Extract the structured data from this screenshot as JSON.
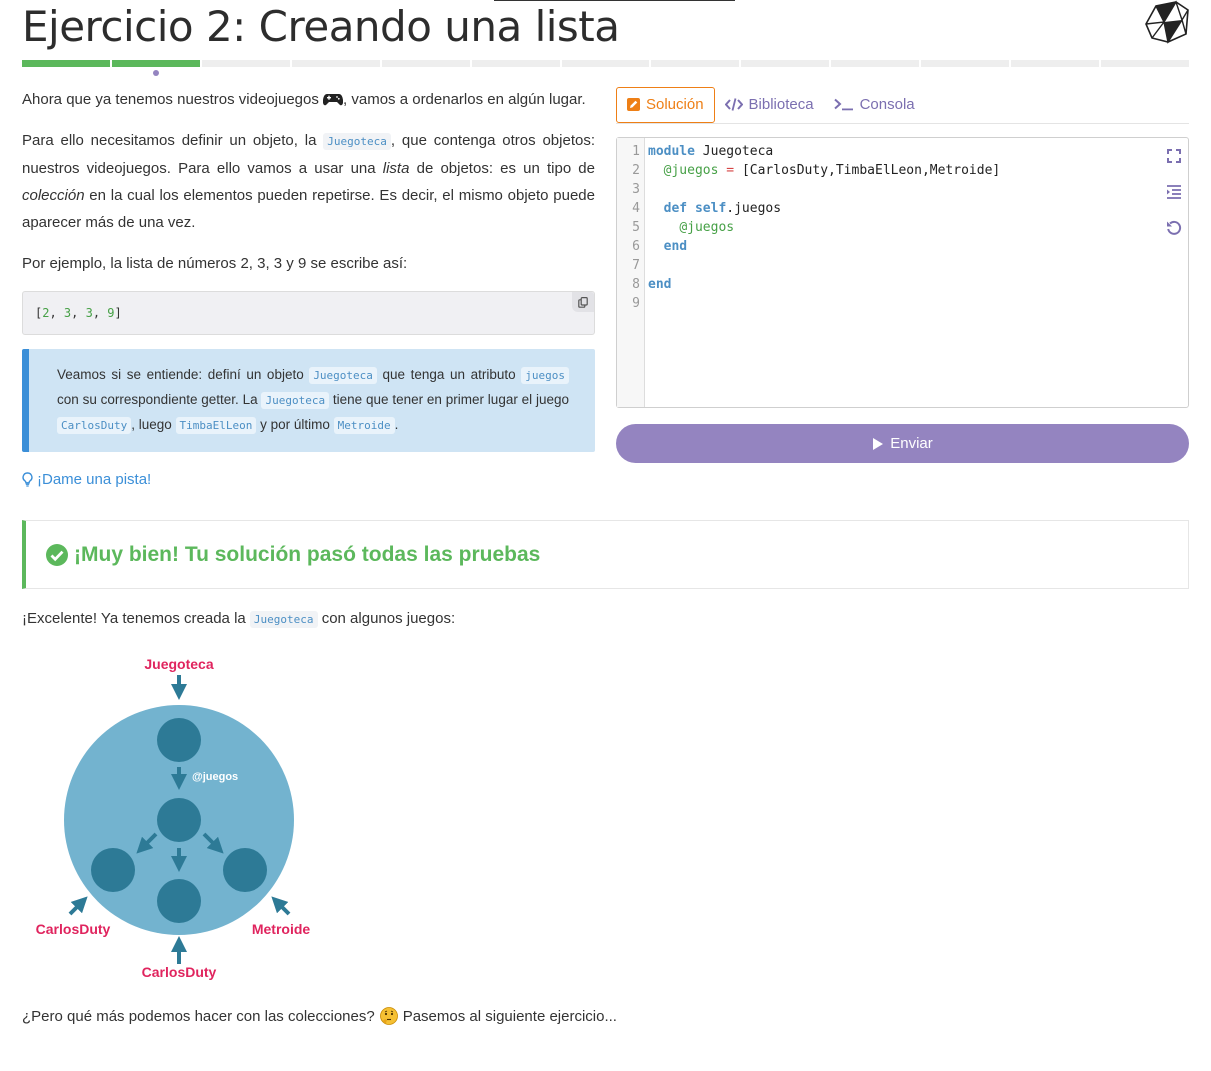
{
  "header": {
    "title": "Ejercicio 2: Creando una lista",
    "progress": {
      "total": 13,
      "completed": 2,
      "current": 2
    }
  },
  "description": {
    "intro_text": "Ahora que ya tenemos nuestros videojuegos",
    "intro_text_end": ", vamos a ordenarlos en algún lugar.",
    "p2_a": "Para ello necesitamos definir un objeto, la ",
    "p2_code": "Juegoteca",
    "p2_b": ", que contenga otros objetos: nuestros videojuegos. Para ello vamos a usar una ",
    "p2_em1": "lista",
    "p2_c": " de objetos: es un tipo de ",
    "p2_em2": "colección",
    "p2_d": " en la cual los elementos pueden repetirse. Es decir, el mismo objeto puede aparecer más de una vez.",
    "p3": "Por ejemplo, la lista de números 2, 3, 3 y 9 se escribe así:"
  },
  "example_code": {
    "open": "[",
    "n1": "2",
    "n2": "3",
    "n3": "3",
    "n4": "9",
    "sep": ", ",
    "close": "]"
  },
  "assignment": {
    "a": "Veamos si se entiende: definí un objeto ",
    "code1": "Juegoteca",
    "b": " que tenga un atributo ",
    "code2": "juegos",
    "c": " con su correspondiente getter. La ",
    "code3": "Juegoteca",
    "d": " tiene que tener en primer lugar el juego ",
    "code4": "CarlosDuty",
    "e": ", luego ",
    "code5": "TimbaElLeon",
    "f": " y por último ",
    "code6": "Metroide",
    "g": "."
  },
  "hint_label": "¡Dame una pista!",
  "tabs": {
    "solution": "Solución",
    "library": "Biblioteca",
    "console": "Consola"
  },
  "editor": {
    "line_numbers": [
      "1",
      "2",
      "3",
      "4",
      "5",
      "6",
      "7",
      "8",
      "9"
    ],
    "l1_kw": "module",
    "l1_txt": " Juegoteca",
    "l2_ivar": "@juegos",
    "l2_eq": " = ",
    "l2_txt": "[CarlosDuty,TimbaElLeon,Metroide]",
    "l4_kw1": "def",
    "l4_kw2": "self",
    "l4_txt": ".juegos",
    "l5_ivar": "@juegos",
    "l6_kw": "end",
    "l8_kw": "end"
  },
  "submit_label": "Enviar",
  "result": {
    "title": "¡Muy bien! Tu solución pasó todas las pruebas",
    "status_color": "#5cb85c"
  },
  "corollary": {
    "a": "¡Excelente! Ya tenemos creada la ",
    "code": "Juegoteca",
    "b": " con algunos juegos:"
  },
  "diagram": {
    "top_label": "Juegoteca",
    "attr_label": "@juegos",
    "left_label": "CarlosDuty",
    "right_label": "Metroide",
    "bottom_label": "CarlosDuty"
  },
  "closing": {
    "a": "¿Pero qué más podemos hacer con las colecciones?",
    "b": "Pasemos al siguiente ejercicio..."
  },
  "colors": {
    "accent_purple": "#9484c0",
    "accent_orange": "#ee7f16",
    "success": "#5cb85c",
    "info": "#3b8fd8",
    "label_red": "#e0245e",
    "diagram_blue": "#73b3cf",
    "diagram_dark": "#2d7a96"
  },
  "icons": [
    "ruby-logo",
    "gamepad",
    "copy",
    "lightbulb",
    "edit",
    "code",
    "terminal",
    "expand",
    "indent",
    "undo",
    "play",
    "check-circle",
    "thinking-face"
  ]
}
